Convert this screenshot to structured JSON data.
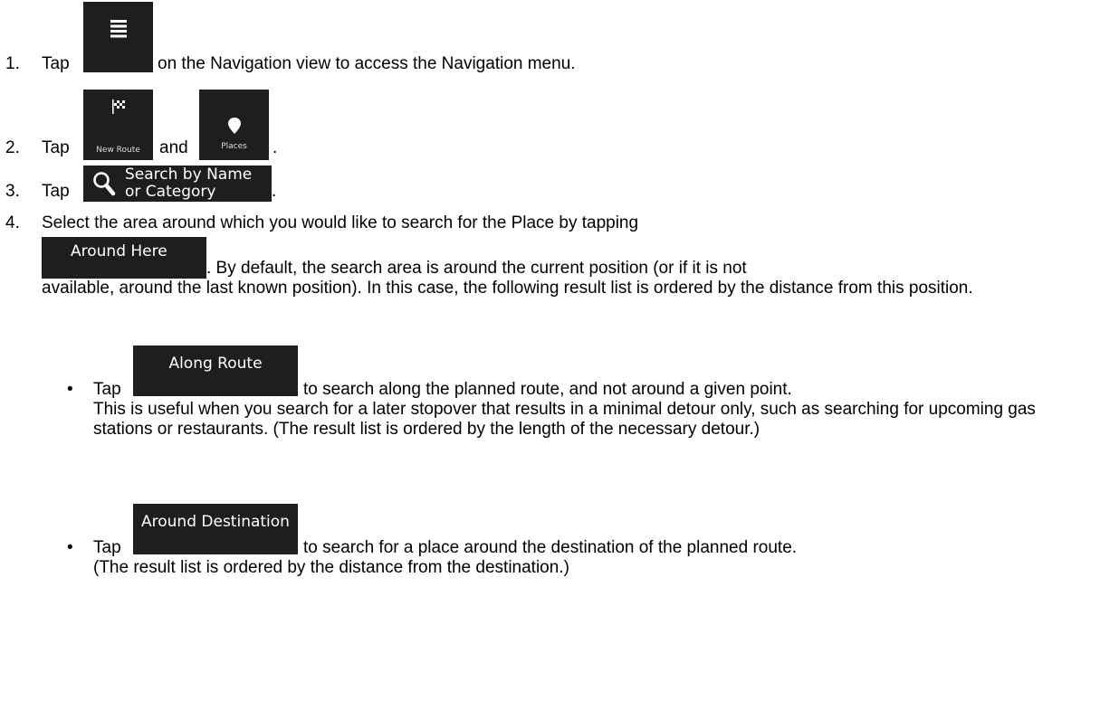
{
  "steps": [
    {
      "num": "1.",
      "tap": "Tap",
      "icon": "menu-icon",
      "text": "on the Navigation view to access the Navigation menu."
    },
    {
      "num": "2.",
      "tap": "Tap",
      "new_route_label": "New Route",
      "new_route_icon": "checkered-flag-icon",
      "and": "and",
      "places_label": "Places",
      "places_icon": "map-pin-icon",
      "end": "."
    },
    {
      "num": "3.",
      "tap": "Tap",
      "search_icon": "search-icon",
      "search_label_line1": "Search by Name",
      "search_label_line2": "or Category",
      "end": "."
    },
    {
      "num": "4.",
      "text_line1": "Select the area around which you would like to search for the Place by tapping",
      "around_here_label": "Around Here",
      "text_after_button": ". By default, the search area is around the current position (or if it is not",
      "text_rest": "available, around the last known position). In this case, the following result list is ordered by the distance from this position."
    }
  ],
  "bullets": [
    {
      "tap": "Tap",
      "button_label": "Along Route",
      "text_after": "to search along the planned route, and not around a given point.",
      "text_rest": "This is useful when you search for a later stopover that results in a minimal detour only, such as searching for upcoming gas stations or restaurants. (The result list is ordered by the length of the necessary detour.)"
    },
    {
      "tap": "Tap",
      "button_label": "Around Destination",
      "text_after": "to search for a place around the destination of the planned route.",
      "text_rest": "(The result list is ordered by the distance from the destination.)"
    }
  ]
}
